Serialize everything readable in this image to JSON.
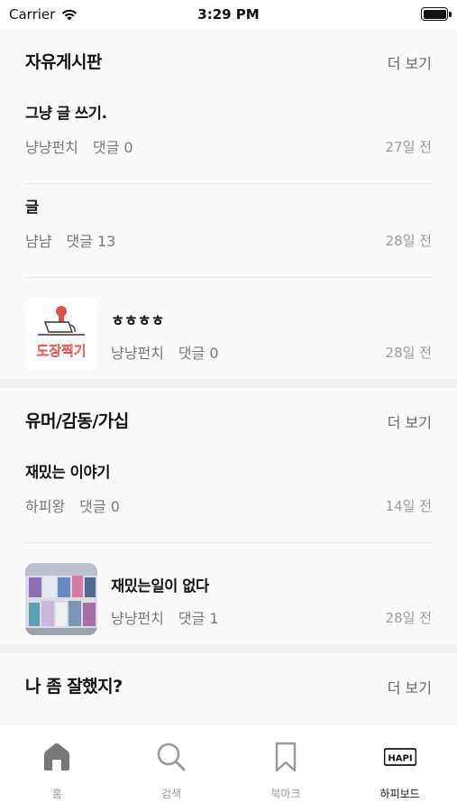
{
  "status_bar": {
    "carrier": "Carrier",
    "time": "3:29 PM"
  },
  "sections": [
    {
      "title": "자유게시판",
      "more_label": "더 보기",
      "posts": [
        {
          "title": "그냥 글 쓰기.",
          "author": "냥냥펀치",
          "comments": "댓글 0",
          "date": "27일 전"
        },
        {
          "title": "글",
          "author": "냠냠",
          "comments": "댓글 13",
          "date": "28일 전"
        },
        {
          "title": "ㅎㅎㅎㅎ",
          "author": "냥냥펀치",
          "comments": "댓글 0",
          "date": "28일 전",
          "thumbnail_text": "도장찍기"
        }
      ]
    },
    {
      "title": "유머/감동/가십",
      "more_label": "더 보기",
      "posts": [
        {
          "title": "재밌는 이야기",
          "author": "하피왕",
          "comments": "댓글 0",
          "date": "14일 전"
        },
        {
          "title": "재밌는일이 없다",
          "author": "냥냥펀치",
          "comments": "댓글 1",
          "date": "28일 전"
        }
      ]
    },
    {
      "title": "나 좀 잘했지?",
      "more_label": "더 보기"
    }
  ],
  "tab_bar": {
    "tabs": [
      {
        "label": "홈",
        "icon": "home-icon"
      },
      {
        "label": "검색",
        "icon": "search-icon"
      },
      {
        "label": "북마크",
        "icon": "bookmark-icon"
      },
      {
        "label": "하피보드",
        "icon": "hapi-logo-icon",
        "icon_text": "HAPI",
        "active": true
      }
    ]
  }
}
